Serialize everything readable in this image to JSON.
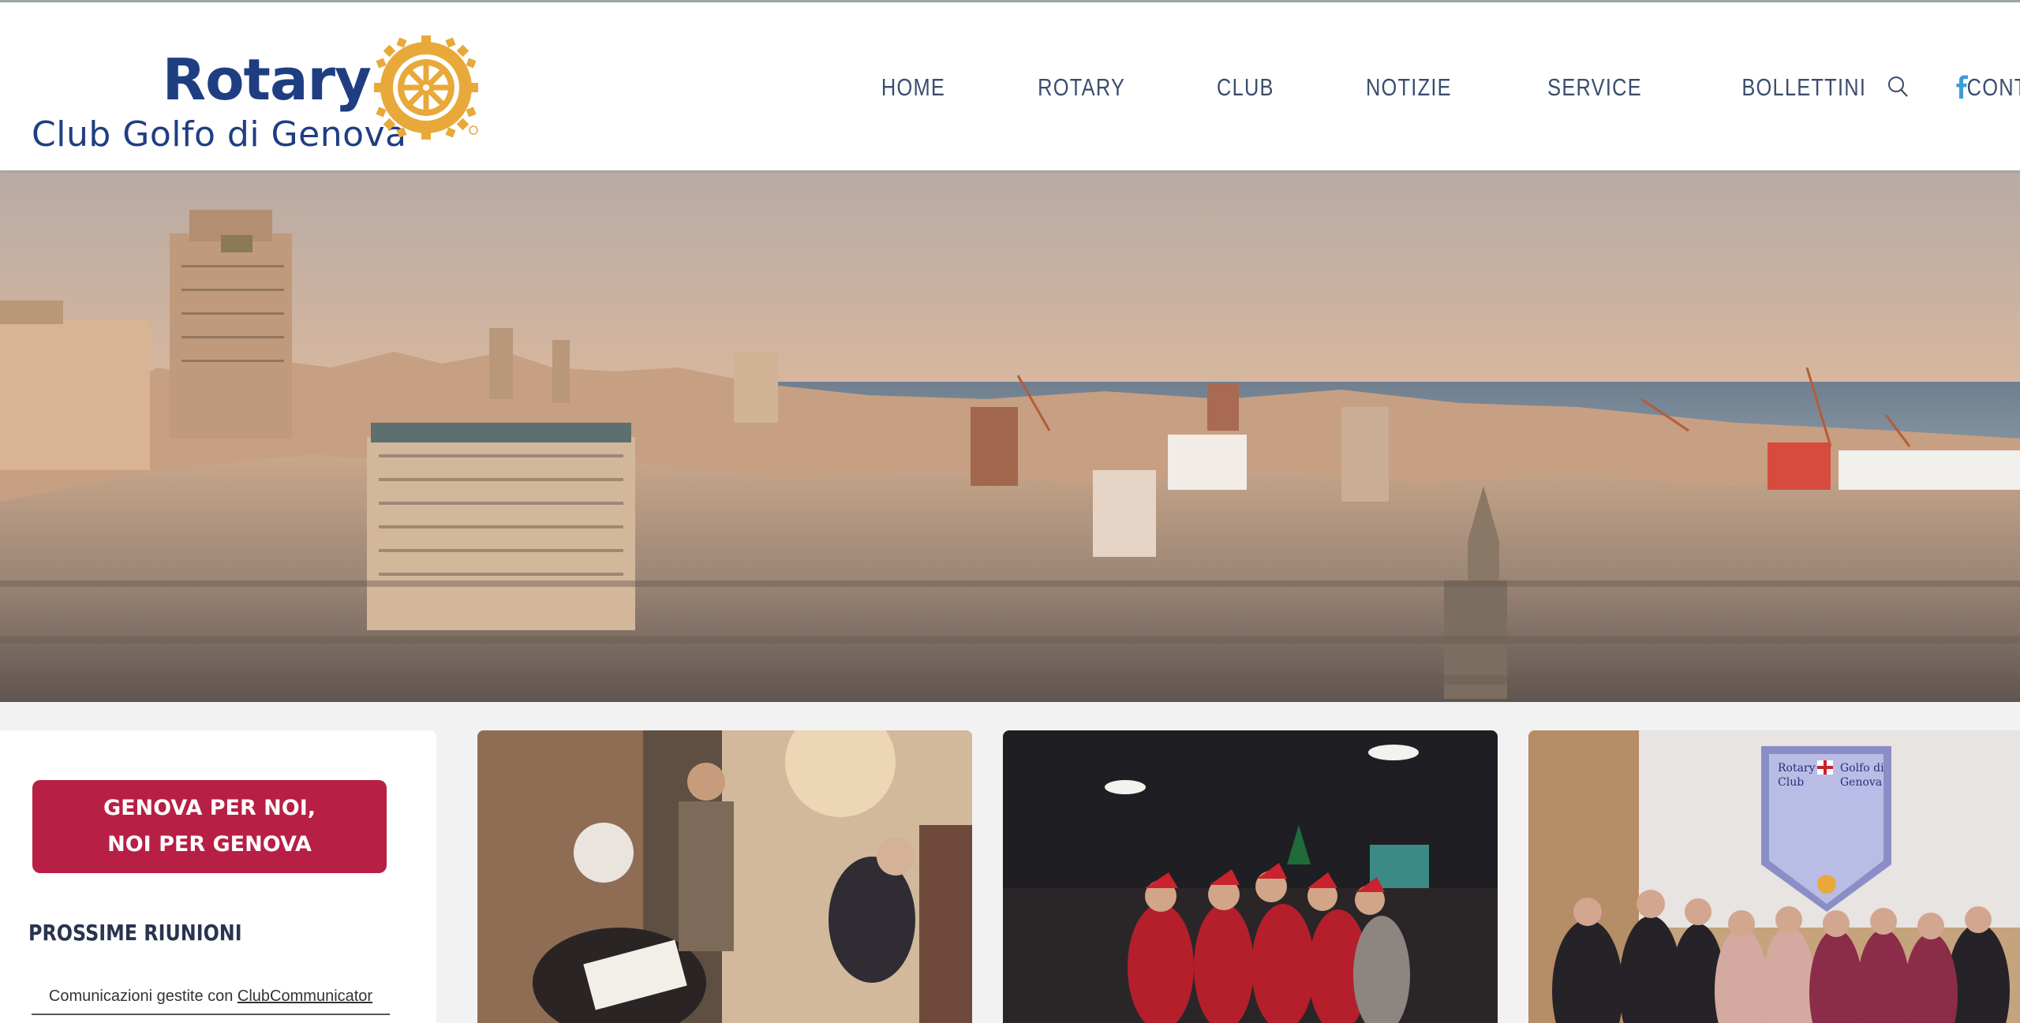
{
  "brand": {
    "rotary": "Rotary",
    "club": "Club Golfo di Genova",
    "wheel_text": "ROTARY INTERNATIONAL",
    "logo_blue": "#1f3e82",
    "logo_gold": "#e8a93a"
  },
  "nav": {
    "items": [
      {
        "label": "HOME",
        "active": true
      },
      {
        "label": "ROTARY"
      },
      {
        "label": "CLUB"
      },
      {
        "label": "NOTIZIE"
      },
      {
        "label": "SERVICE"
      },
      {
        "label": "BOLLETTINI"
      },
      {
        "label": "CONTATTI"
      }
    ],
    "search_icon": "search-icon",
    "social_icon": "facebook-icon",
    "text_color": "#3a4c6e",
    "social_color": "#3b9ed8"
  },
  "sidebar": {
    "cta_line1": "GENOVA PER NOI,",
    "cta_line2": "NOI PER GENOVA",
    "cta_color": "#b81f45",
    "section_title": "PROSSIME RIUNIONI",
    "comm_text": "Comunicazioni gestite con ",
    "comm_link": "ClubCommunicator"
  },
  "cards": [
    {
      "icon": "photo-meeting"
    },
    {
      "icon": "photo-christmas-group"
    },
    {
      "icon": "photo-club-banner"
    }
  ],
  "banner": {
    "line1": "Rotary",
    "line2": "Club",
    "line3": "Golfo di",
    "line4": "Genova"
  }
}
